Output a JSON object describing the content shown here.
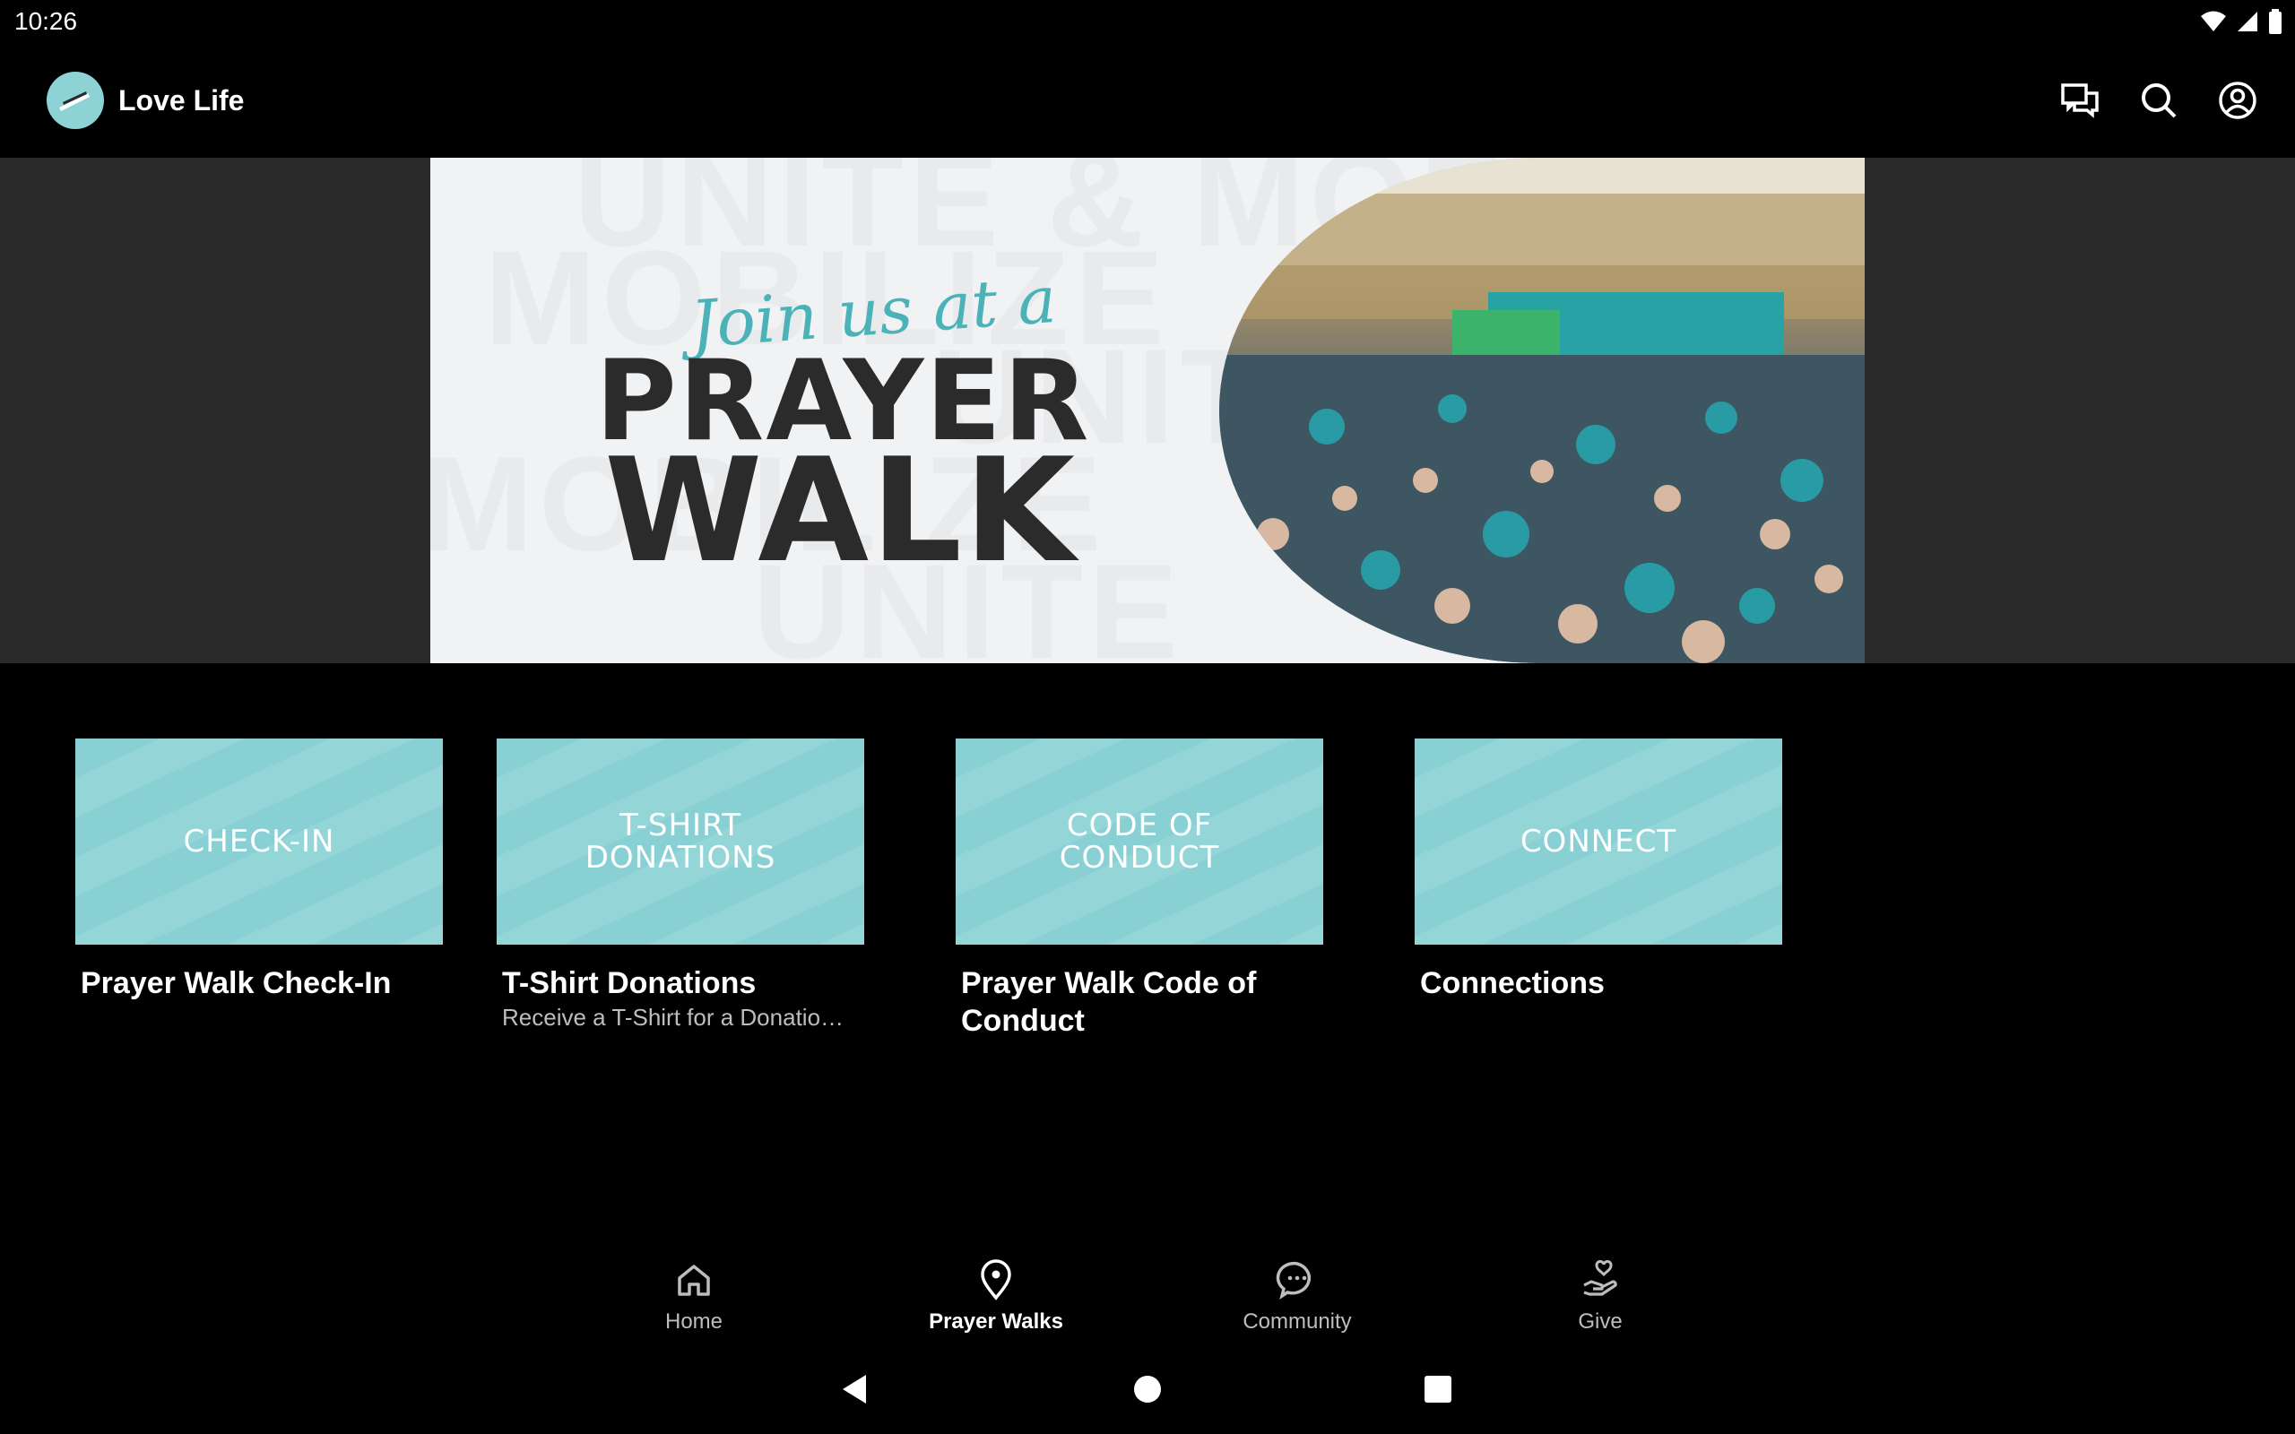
{
  "status_bar": {
    "time": "10:26"
  },
  "app_bar": {
    "title": "Love Life",
    "actions": [
      "chat-icon",
      "search-icon",
      "account-icon"
    ]
  },
  "hero": {
    "script_text": "Join us at a",
    "line1": "PRAYER",
    "line2": "WALK",
    "watermark": [
      "UNITE & MOBILIZE",
      "MOBILIZE",
      "UNITE",
      "MOBILIZE",
      "UNITE"
    ]
  },
  "cards": [
    {
      "thumb_text": "CHECK-IN",
      "title": "Prayer Walk Check-In",
      "subtitle": ""
    },
    {
      "thumb_text": "T-SHIRT\nDONATIONS",
      "title": "T-Shirt Donations",
      "subtitle": "Receive a T-Shirt for a Donatio…"
    },
    {
      "thumb_text": "CODE OF\nCONDUCT",
      "title": "Prayer Walk Code of Conduct",
      "subtitle": ""
    },
    {
      "thumb_text": "CONNECT",
      "title": "Connections",
      "subtitle": ""
    }
  ],
  "bottom_nav": [
    {
      "label": "Home",
      "icon": "home-icon",
      "active": false
    },
    {
      "label": "Prayer Walks",
      "icon": "location-pin-icon",
      "active": true
    },
    {
      "label": "Community",
      "icon": "chat-bubble-icon",
      "active": false
    },
    {
      "label": "Give",
      "icon": "hand-heart-icon",
      "active": false
    }
  ],
  "colors": {
    "background": "#000000",
    "card_teal": "#88d0d4",
    "hero_bg": "#f1f2f4",
    "hero_script": "#4bb3b8",
    "hero_text": "#2b2b2b"
  }
}
